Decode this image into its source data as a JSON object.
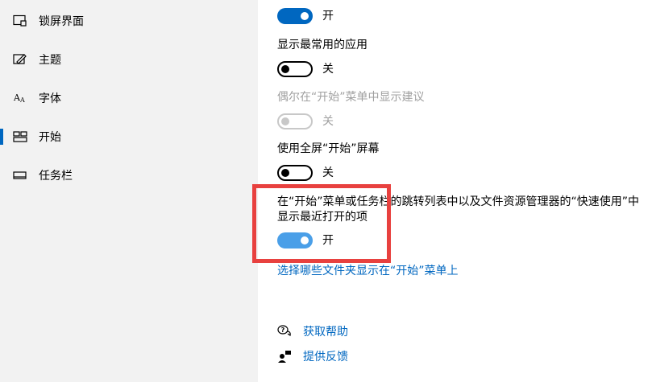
{
  "sidebar": {
    "items": [
      {
        "label": "锁屏界面",
        "icon": "lock-screen-icon",
        "active": false
      },
      {
        "label": "主题",
        "icon": "theme-brush-icon",
        "active": false
      },
      {
        "label": "字体",
        "icon": "font-icon",
        "active": false
      },
      {
        "label": "开始",
        "icon": "start-menu-icon",
        "active": true
      },
      {
        "label": "任务栏",
        "icon": "taskbar-icon",
        "active": false
      }
    ]
  },
  "settings": {
    "top_toggle": {
      "state": "开",
      "on": true
    },
    "most_used": {
      "label": "显示最常用的应用",
      "state": "关",
      "on": false
    },
    "suggestions": {
      "label": "偶尔在“开始”菜单中显示建议",
      "state": "关",
      "on": false,
      "disabled": true
    },
    "fullscreen": {
      "label": "使用全屏“开始”屏幕",
      "state": "关",
      "on": false
    },
    "recent": {
      "label_line1": "在“开始”菜单或任务栏的跳转列表中以及文件资源管理器的“快速使用”中",
      "label_line2": "显示最近打开的项",
      "state": "开",
      "on": true
    }
  },
  "links": {
    "choose_folders": "选择哪些文件夹显示在“开始”菜单上"
  },
  "help": {
    "get_help": "获取帮助",
    "feedback": "提供反馈"
  },
  "colors": {
    "accent": "#0067c0",
    "highlight_border": "#e8413f",
    "sidebar_bg": "#f2f2f2"
  }
}
